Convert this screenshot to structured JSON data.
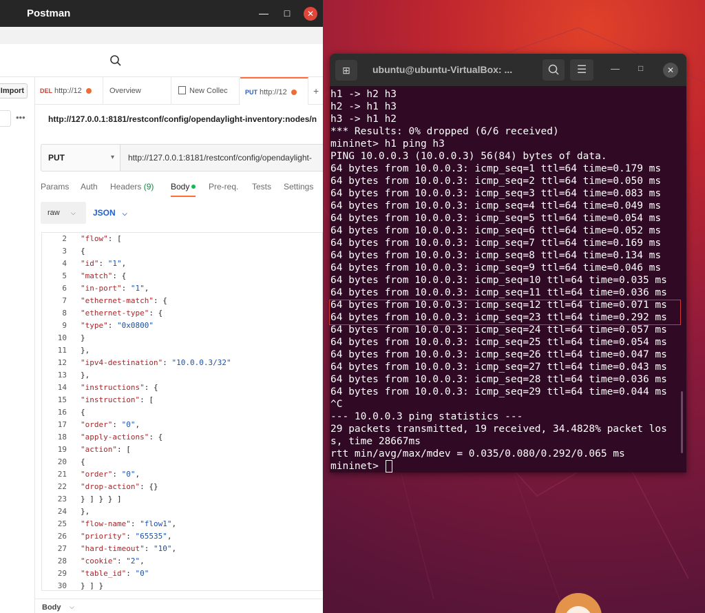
{
  "postman": {
    "title": "Postman",
    "import_label": "Import",
    "more_label": "•••",
    "tabs": [
      {
        "method": "DEL",
        "label": "http://12"
      },
      {
        "method": "",
        "label": "Overview"
      },
      {
        "method": "",
        "label": "New Collec"
      },
      {
        "method": "PUT",
        "label": "http://12"
      }
    ],
    "url_title": "http://127.0.0.1:8181/restconf/config/opendaylight-inventory:nodes/n",
    "method": "PUT",
    "url_value": "http://127.0.0.1:8181/restconf/config/opendaylight-",
    "subtabs": {
      "params": "Params",
      "auth": "Auth",
      "headers": "Headers",
      "headers_count": "(9)",
      "body": "Body",
      "prereq": "Pre-req.",
      "tests": "Tests",
      "settings": "Settings"
    },
    "body_mode": "raw",
    "body_format": "JSON",
    "bottom_label": "Body",
    "code": [
      {
        "n": "2",
        "t": "\"flow\": ["
      },
      {
        "n": "3",
        "t": "{"
      },
      {
        "n": "4",
        "t": "\"id\": \"1\","
      },
      {
        "n": "5",
        "t": "\"match\": {"
      },
      {
        "n": "6",
        "t": "\"in-port\": \"1\","
      },
      {
        "n": "7",
        "t": "\"ethernet-match\": {"
      },
      {
        "n": "8",
        "t": "\"ethernet-type\": {"
      },
      {
        "n": "9",
        "t": "\"type\": \"0x0800\""
      },
      {
        "n": "10",
        "t": "}"
      },
      {
        "n": "11",
        "t": "},"
      },
      {
        "n": "12",
        "t": "\"ipv4-destination\": \"10.0.0.3/32\""
      },
      {
        "n": "13",
        "t": "},"
      },
      {
        "n": "14",
        "t": "\"instructions\": {"
      },
      {
        "n": "15",
        "t": "\"instruction\": ["
      },
      {
        "n": "16",
        "t": "{"
      },
      {
        "n": "17",
        "t": "\"order\": \"0\","
      },
      {
        "n": "18",
        "t": "\"apply-actions\": {"
      },
      {
        "n": "19",
        "t": "\"action\": ["
      },
      {
        "n": "20",
        "t": "{"
      },
      {
        "n": "21",
        "t": "\"order\": \"0\","
      },
      {
        "n": "22",
        "t": "\"drop-action\": {}"
      },
      {
        "n": "23",
        "t": "} ] } } ]"
      },
      {
        "n": "24",
        "t": "},"
      },
      {
        "n": "25",
        "t": "\"flow-name\": \"flow1\","
      },
      {
        "n": "26",
        "t": "\"priority\": \"65535\","
      },
      {
        "n": "27",
        "t": "\"hard-timeout\": \"10\","
      },
      {
        "n": "28",
        "t": "\"cookie\": \"2\","
      },
      {
        "n": "29",
        "t": "\"table_id\": \"0\""
      },
      {
        "n": "30",
        "t": "} ] }"
      }
    ]
  },
  "terminal": {
    "title": "ubuntu@ubuntu-VirtualBox: ...",
    "lines": [
      "h1 -> h2 h3",
      "h2 -> h1 h3",
      "h3 -> h1 h2",
      "*** Results: 0% dropped (6/6 received)",
      "mininet> h1 ping h3",
      "PING 10.0.0.3 (10.0.0.3) 56(84) bytes of data.",
      "64 bytes from 10.0.0.3: icmp_seq=1 ttl=64 time=0.179 ms",
      "64 bytes from 10.0.0.3: icmp_seq=2 ttl=64 time=0.050 ms",
      "64 bytes from 10.0.0.3: icmp_seq=3 ttl=64 time=0.083 ms",
      "64 bytes from 10.0.0.3: icmp_seq=4 ttl=64 time=0.049 ms",
      "64 bytes from 10.0.0.3: icmp_seq=5 ttl=64 time=0.054 ms",
      "64 bytes from 10.0.0.3: icmp_seq=6 ttl=64 time=0.052 ms",
      "64 bytes from 10.0.0.3: icmp_seq=7 ttl=64 time=0.169 ms",
      "64 bytes from 10.0.0.3: icmp_seq=8 ttl=64 time=0.134 ms",
      "64 bytes from 10.0.0.3: icmp_seq=9 ttl=64 time=0.046 ms",
      "64 bytes from 10.0.0.3: icmp_seq=10 ttl=64 time=0.035 ms",
      "64 bytes from 10.0.0.3: icmp_seq=11 ttl=64 time=0.036 ms",
      "64 bytes from 10.0.0.3: icmp_seq=12 ttl=64 time=0.071 ms",
      "64 bytes from 10.0.0.3: icmp_seq=23 ttl=64 time=0.292 ms",
      "64 bytes from 10.0.0.3: icmp_seq=24 ttl=64 time=0.057 ms",
      "64 bytes from 10.0.0.3: icmp_seq=25 ttl=64 time=0.054 ms",
      "64 bytes from 10.0.0.3: icmp_seq=26 ttl=64 time=0.047 ms",
      "64 bytes from 10.0.0.3: icmp_seq=27 ttl=64 time=0.043 ms",
      "64 bytes from 10.0.0.3: icmp_seq=28 ttl=64 time=0.036 ms",
      "64 bytes from 10.0.0.3: icmp_seq=29 ttl=64 time=0.044 ms",
      "^C",
      "--- 10.0.0.3 ping statistics ---",
      "29 packets transmitted, 19 received, 34.4828% packet los",
      "s, time 28667ms",
      "rtt min/avg/max/mdev = 0.035/0.080/0.292/0.065 ms",
      "mininet> "
    ]
  },
  "colors": {
    "postman_accent": "#ff6c37",
    "terminal_bg": "#300a24",
    "highlight_border": "#d23a3a",
    "json_key": "#a3282c",
    "json_string": "#1c4fa5"
  }
}
